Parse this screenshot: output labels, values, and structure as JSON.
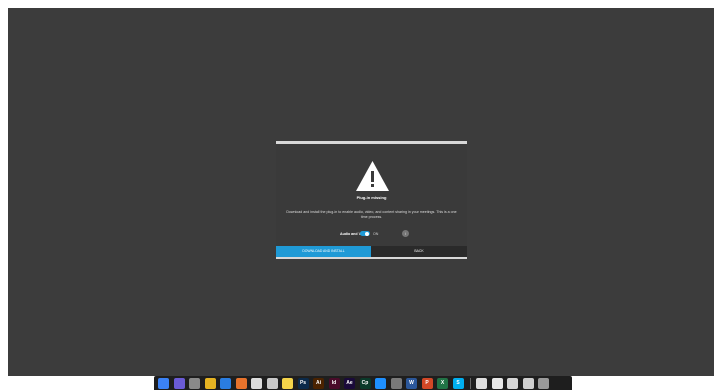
{
  "dialog": {
    "title": "Plug-in missing",
    "description": "Download and install the plug-in to enable audio, video, and content sharing in your meetings. This is a one time process.",
    "av_label": "Audio and Video",
    "toggle_state": "ON",
    "toggle_on": true,
    "primary_button": "DOWNLOAD AND INSTALL",
    "back_button": "BACK",
    "icons": {
      "warning": "warning-triangle-icon",
      "info": "info-icon"
    },
    "colors": {
      "accent": "#1f9ad6",
      "dialog_bg": "#3a3a3a",
      "desktop_bg": "#3c3c3c"
    }
  },
  "dock": {
    "apps": [
      {
        "name": "finder",
        "glyph": "",
        "color": "#3b82f6"
      },
      {
        "name": "siri",
        "glyph": "",
        "color": "#6b5bd6"
      },
      {
        "name": "launchpad",
        "glyph": "",
        "color": "#8a8a8a"
      },
      {
        "name": "chrome",
        "glyph": "",
        "color": "#e6b422"
      },
      {
        "name": "safari",
        "glyph": "",
        "color": "#2a7de1"
      },
      {
        "name": "firefox",
        "glyph": "",
        "color": "#e8732c"
      },
      {
        "name": "calendar",
        "glyph": "",
        "color": "#dddddd"
      },
      {
        "name": "photos",
        "glyph": "",
        "color": "#c9c9c9"
      },
      {
        "name": "notes",
        "glyph": "",
        "color": "#f3d34a"
      },
      {
        "name": "photoshop",
        "glyph": "Ps",
        "color": "#0b2a4a"
      },
      {
        "name": "illustrator",
        "glyph": "Ai",
        "color": "#4a2200"
      },
      {
        "name": "indesign",
        "glyph": "Id",
        "color": "#4a0b2a"
      },
      {
        "name": "after-effects",
        "glyph": "Ae",
        "color": "#1a0a3a"
      },
      {
        "name": "character-animator",
        "glyph": "Cp",
        "color": "#0a3a2a"
      },
      {
        "name": "app-store",
        "glyph": "",
        "color": "#1e90ff"
      },
      {
        "name": "system-preferences",
        "glyph": "",
        "color": "#7a7a7a"
      },
      {
        "name": "word",
        "glyph": "W",
        "color": "#2b579a"
      },
      {
        "name": "powerpoint",
        "glyph": "P",
        "color": "#d24726"
      },
      {
        "name": "excel",
        "glyph": "X",
        "color": "#217346"
      },
      {
        "name": "skype",
        "glyph": "S",
        "color": "#00aff0"
      },
      {
        "name": "files",
        "glyph": "",
        "color": "#dedede"
      },
      {
        "name": "documents",
        "glyph": "",
        "color": "#e8e8e8"
      },
      {
        "name": "downloads",
        "glyph": "",
        "color": "#d6d6d6"
      },
      {
        "name": "folder",
        "glyph": "",
        "color": "#cfcfcf"
      },
      {
        "name": "trash",
        "glyph": "",
        "color": "#9a9a9a"
      }
    ]
  }
}
